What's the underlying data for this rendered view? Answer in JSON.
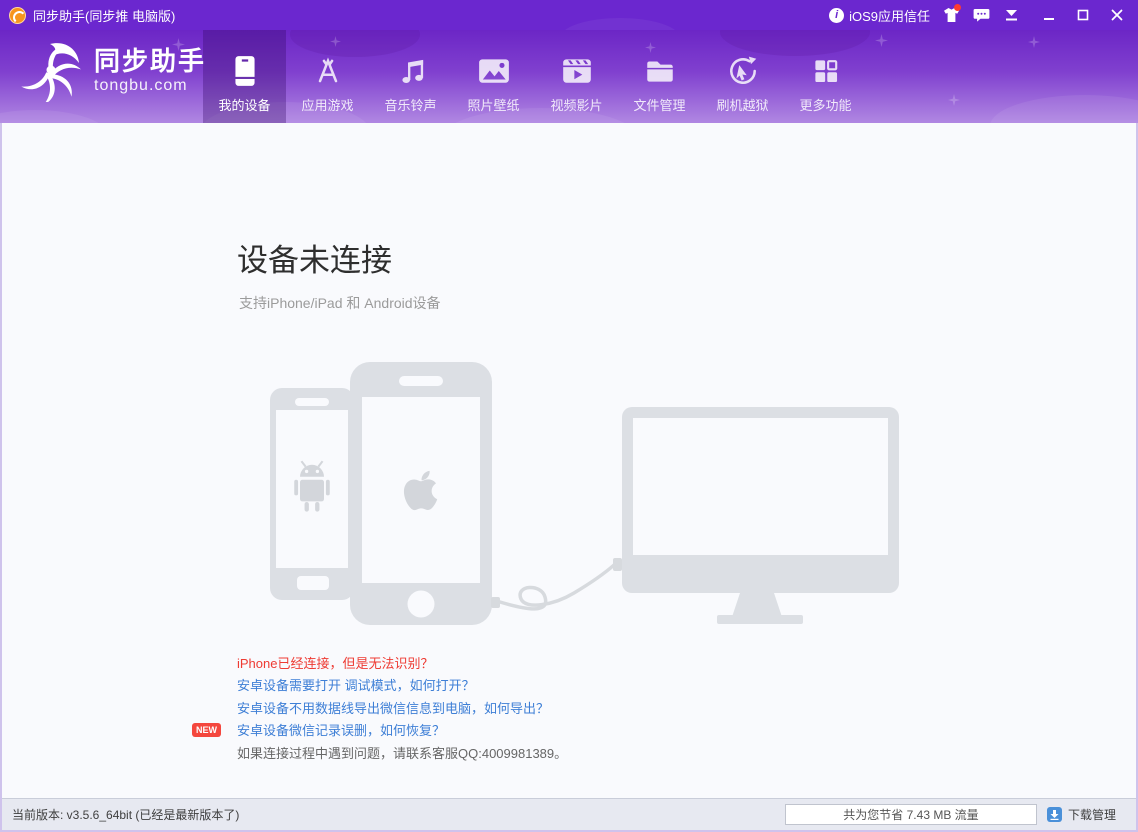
{
  "titlebar": {
    "app_title": "同步助手(同步推 电脑版)",
    "trust_label": "iOS9应用信任"
  },
  "logo": {
    "name": "同步助手",
    "domain": "tongbu.com"
  },
  "nav": {
    "items": [
      {
        "label": "我的设备",
        "active": true
      },
      {
        "label": "应用游戏",
        "active": false
      },
      {
        "label": "音乐铃声",
        "active": false
      },
      {
        "label": "照片壁纸",
        "active": false
      },
      {
        "label": "视频影片",
        "active": false
      },
      {
        "label": "文件管理",
        "active": false
      },
      {
        "label": "刷机越狱",
        "active": false
      },
      {
        "label": "更多功能",
        "active": false
      }
    ]
  },
  "main": {
    "title": "设备未连接",
    "subtitle": "支持iPhone/iPad 和 Android设备",
    "links": [
      {
        "text": "iPhone已经连接，但是无法识别？",
        "style": "red"
      },
      {
        "text": "安卓设备需要打开 调试模式，如何打开？",
        "style": "blue"
      },
      {
        "text": "安卓设备不用数据线导出微信信息到电脑，如何导出？",
        "style": "blue"
      },
      {
        "text": "安卓设备微信记录误删，如何恢复？",
        "style": "blue",
        "badge": "NEW"
      },
      {
        "text": "如果连接过程中遇到问题，请联系客服QQ:4009981389。",
        "style": "gray"
      }
    ]
  },
  "statusbar": {
    "version_text": "当前版本: v3.5.6_64bit  (已经是最新版本了)",
    "savings_text": "共为您节省  7.43 MB 流量",
    "download_label": "下载管理"
  },
  "colors": {
    "brand_purple": "#6b27cf",
    "nav_gradient_bottom": "#b087e2",
    "link_blue": "#3e7fd6",
    "alert_red": "#ee3b33",
    "badge_red": "#f4473e",
    "download_blue": "#4a90d9",
    "app_icon_orange": "#f7941d"
  }
}
